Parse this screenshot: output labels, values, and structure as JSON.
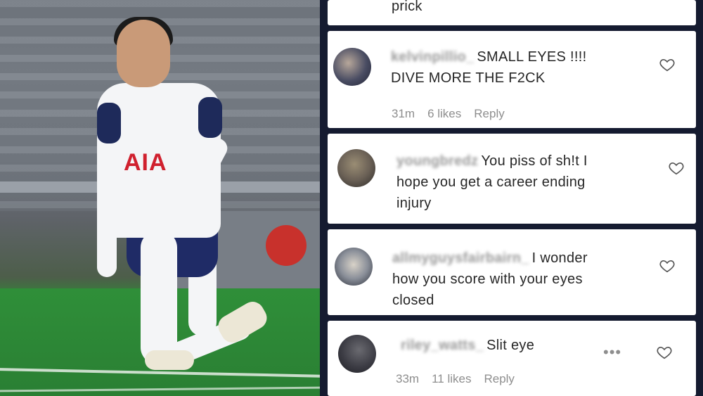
{
  "comments": [
    {
      "username": "",
      "text": "prick",
      "time": "",
      "likes": "",
      "reply": ""
    },
    {
      "username": "kelvinpillio_",
      "text": "SMALL EYES !!!!",
      "text2": "DIVE MORE THE F2CK",
      "time": "31m",
      "likes": "6 likes",
      "reply": "Reply"
    },
    {
      "username": "youngbredz",
      "text": "You piss of sh!t I",
      "text2": "hope you get a career ending",
      "text3": "injury",
      "time": "",
      "likes": "",
      "reply": ""
    },
    {
      "username": "allmyguysfairbairn_",
      "text": "I wonder",
      "text2": "how you score with your eyes",
      "text3": "closed",
      "time": "",
      "likes": "",
      "reply": ""
    },
    {
      "username": "riley_watts_",
      "text": "Slit eye",
      "more": "•••",
      "time": "33m",
      "likes": "11 likes",
      "reply": "Reply"
    }
  ],
  "photo": {
    "sponsor": "AIA"
  },
  "icons": {
    "like": "heart-outline-icon",
    "more": "more-dots-icon"
  }
}
